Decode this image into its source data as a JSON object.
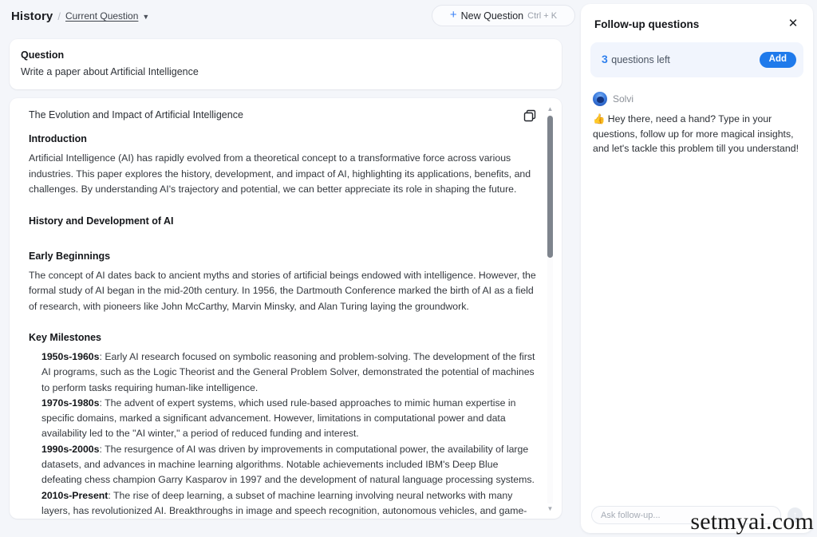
{
  "breadcrumb": {
    "title": "History",
    "separator": "/",
    "current": "Current Question",
    "chevron_icon": "chevron-down-icon"
  },
  "new_question_button": {
    "plus_icon": "plus-icon",
    "label": "New Question",
    "shortcut": "Ctrl + K"
  },
  "question_card": {
    "label": "Question",
    "text": "Write a paper about Artificial Intelligence"
  },
  "answer": {
    "doc_title": "The Evolution and Impact of Artificial Intelligence",
    "copy_icon": "copy-icon",
    "sections": {
      "introduction_heading": "Introduction",
      "introduction_body": "Artificial Intelligence (AI) has rapidly evolved from a theoretical concept to a transformative force across various industries. This paper explores the history, development, and impact of AI, highlighting its applications, benefits, and challenges. By understanding AI's trajectory and potential, we can better appreciate its role in shaping the future.",
      "history_heading": "History and Development of AI",
      "early_beginnings_heading": "Early Beginnings",
      "early_beginnings_body": "The concept of AI dates back to ancient myths and stories of artificial beings endowed with intelligence. However, the formal study of AI began in the mid-20th century. In 1956, the Dartmouth Conference marked the birth of AI as a field of research, with pioneers like John McCarthy, Marvin Minsky, and Alan Turing laying the groundwork.",
      "key_milestones_heading": "Key Milestones"
    },
    "milestones": [
      {
        "period": "1950s-1960s",
        "text": ": Early AI research focused on symbolic reasoning and problem-solving. The development of the first AI programs, such as the Logic Theorist and the General Problem Solver, demonstrated the potential of machines to perform tasks requiring human-like intelligence."
      },
      {
        "period": "1970s-1980s",
        "text": ": The advent of expert systems, which used rule-based approaches to mimic human expertise in specific domains, marked a significant advancement. However, limitations in computational power and data availability led to the \"AI winter,\" a period of reduced funding and interest."
      },
      {
        "period": "1990s-2000s",
        "text": ": The resurgence of AI was driven by improvements in computational power, the availability of large datasets, and advances in machine learning algorithms. Notable achievements included IBM's Deep Blue defeating chess champion Garry Kasparov in 1997 and the development of natural language processing systems."
      },
      {
        "period": "2010s-Present",
        "text": ": The rise of deep learning, a subset of machine learning involving neural networks with many layers, has revolutionized AI. Breakthroughs in image and speech recognition, autonomous vehicles, and game-playing AI, such as AlphaGo, have demonstrated the power of deep learning."
      }
    ],
    "scrollbar": {
      "up_arrow_icon": "triangle-up-icon",
      "down_arrow_icon": "triangle-down-icon"
    }
  },
  "followup_panel": {
    "title": "Follow-up questions",
    "close_icon": "close-icon",
    "quota": {
      "count": "3",
      "label": "questions left",
      "add_label": "Add"
    },
    "assistant": {
      "avatar_icon": "solvi-avatar-icon",
      "name": "Solvi",
      "message": "👍 Hey there, need a hand? Type in your questions, follow up for more magical insights, and let's tackle this problem till you understand!"
    },
    "composer": {
      "placeholder": "Ask follow-up...",
      "value": "",
      "send_icon": "arrow-up-icon"
    }
  },
  "watermark": "setmyai.com",
  "colors": {
    "accent_blue": "#1f7aeb",
    "plus_blue": "#3b82f6",
    "page_bg": "#f4f6fa",
    "banner_bg": "#f1f5fd"
  }
}
